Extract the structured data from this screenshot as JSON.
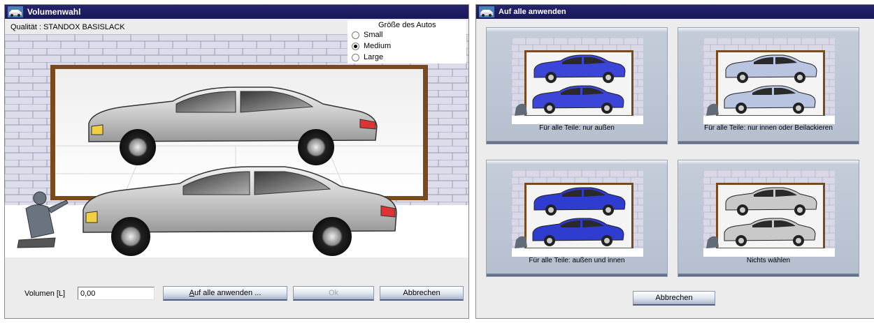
{
  "left_window": {
    "title": "Volumenwahl",
    "quality": "Qualität : STANDOX BASISLACK",
    "car_size": {
      "title": "Größe des Autos",
      "options": [
        "Small",
        "Medium",
        "Large"
      ],
      "selected": "Medium"
    },
    "volume_label": "Volumen [L]",
    "volume_value": "0,00",
    "apply_all_prefix": "A",
    "apply_all_rest": "uf alle anwenden ...",
    "ok_label": "Ok",
    "cancel_label": "Abbrechen"
  },
  "right_window": {
    "title": "Auf alle anwenden",
    "options": [
      {
        "label": "Für alle Teile: nur außen",
        "top_color": "#3b46d8",
        "bottom_color": "#3b46d8"
      },
      {
        "label": "Für alle Teile: nur innen oder Beilackieren",
        "top_color": "#b8c4e0",
        "bottom_color": "#b8c4e0"
      },
      {
        "label": "Für alle Teile: außen und innen",
        "top_color": "#2f3cd0",
        "bottom_color": "#2f3cd0"
      },
      {
        "label": "Nichts wählen",
        "top_color": "#c9c9c9",
        "bottom_color": "#c9c9c9"
      }
    ],
    "cancel_label": "Abbrechen"
  }
}
